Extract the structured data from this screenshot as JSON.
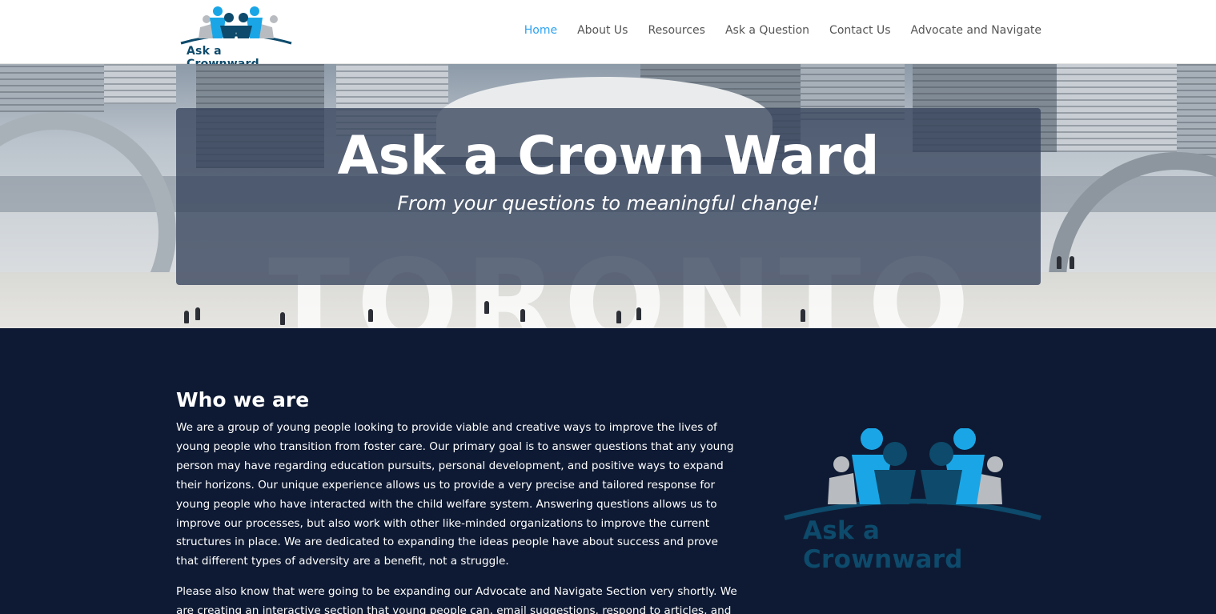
{
  "header": {
    "logo_text": "Ask a Crownward",
    "nav": [
      {
        "label": "Home",
        "active": true
      },
      {
        "label": "About Us",
        "active": false
      },
      {
        "label": "Resources",
        "active": false
      },
      {
        "label": "Ask a Question",
        "active": false
      },
      {
        "label": "Contact Us",
        "active": false
      },
      {
        "label": "Advocate and Navigate",
        "active": false
      }
    ]
  },
  "hero": {
    "title": "Ask a Crown Ward",
    "subtitle": "From your questions to meaningful change!",
    "background_text": "TORONTO"
  },
  "about": {
    "title": "Who we are",
    "paragraph1": "We are a group of young people looking to provide viable and creative ways to improve the lives of young people who transition from foster care. Our primary goal is to answer questions that any young person may have regarding education pursuits, personal development, and positive ways to expand their horizons. Our unique experience allows us to provide a very precise and tailored response for young people who have interacted with the child welfare system. Answering questions allows us to improve our processes, but also work with other like-minded organizations to improve the current structures in place. We are dedicated to expanding the ideas people have about success and prove that different types of adversity are a benefit, not a struggle.",
    "paragraph2": "Please also know that were going to be expanding our Advocate and Navigate Section very shortly.  We are creating an interactive section that young people can, email suggestions, respond to articles, and review",
    "logo_text": "Ask a Crownward"
  },
  "colors": {
    "nav_active": "#2ea3f2",
    "nav_text": "#555555",
    "content_bg": "#0e1a33",
    "logo_blue": "#0d4a6b",
    "logo_light_blue": "#1aa6e6"
  }
}
